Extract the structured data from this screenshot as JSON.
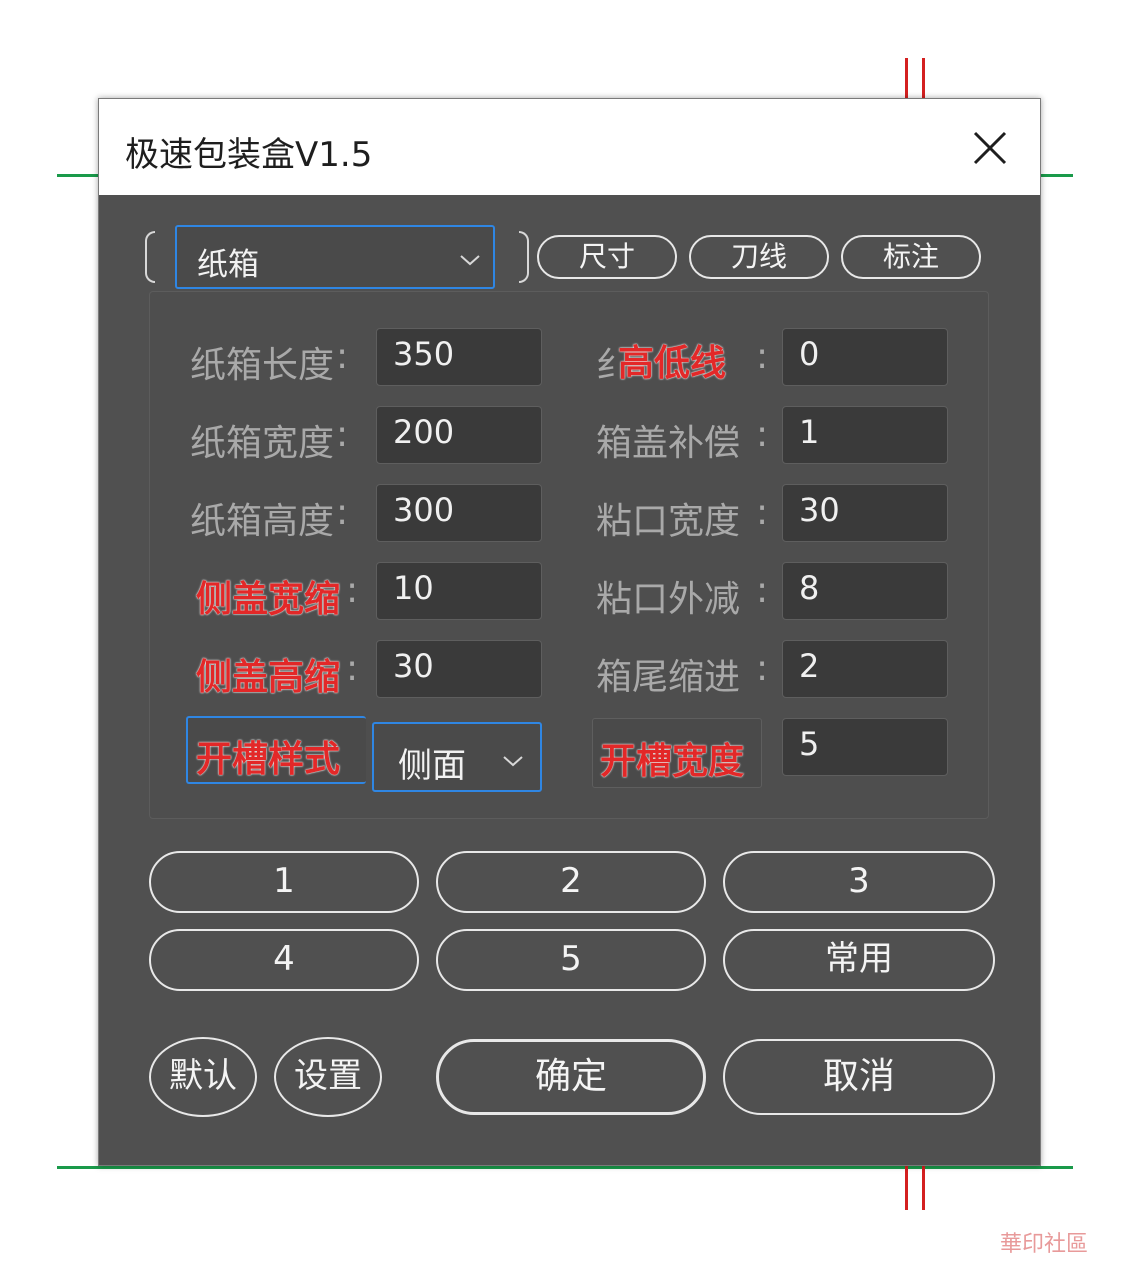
{
  "window": {
    "title": "极速包装盒V1.5"
  },
  "top": {
    "box_type_value": "纸箱",
    "tabs": [
      "尺寸",
      "刀线",
      "标注"
    ]
  },
  "fields_left": [
    {
      "label": "纸箱长度",
      "value": "350"
    },
    {
      "label": "纸箱宽度",
      "value": "200"
    },
    {
      "label": "纸箱高度",
      "value": "300"
    },
    {
      "label": "侧盖宽缩",
      "value": "10"
    },
    {
      "label": "侧盖高缩",
      "value": "30"
    }
  ],
  "fields_right": [
    {
      "label": "高低线",
      "value": "0"
    },
    {
      "label": "箱盖补偿",
      "value": "1"
    },
    {
      "label": "粘口宽度",
      "value": "30"
    },
    {
      "label": "粘口外减",
      "value": "8"
    },
    {
      "label": "箱尾缩进",
      "value": "2"
    }
  ],
  "slot": {
    "style_label": "开槽样式",
    "style_value": "侧面",
    "width_label": "开槽宽度",
    "width_value": "5"
  },
  "presets": [
    "1",
    "2",
    "3",
    "4",
    "5",
    "常用"
  ],
  "actions": {
    "default_label": "默认",
    "settings_label": "设置",
    "ok_label": "确定",
    "cancel_label": "取消"
  },
  "colors": {
    "dialog_bg": "#505050",
    "accent_blue": "#2f86e3",
    "annotation_red": "#e32828",
    "guide_green": "#1a9a4a",
    "guide_red": "#d42020"
  },
  "watermark": "華印社區"
}
